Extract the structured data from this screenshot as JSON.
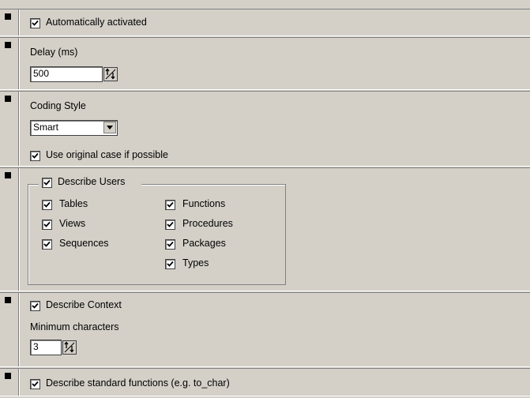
{
  "sections": {
    "auto_activated": {
      "label": "Automatically activated",
      "checked": true
    },
    "delay": {
      "label": "Delay (ms)",
      "value": "500"
    },
    "coding_style": {
      "label": "Coding Style",
      "selected": "Smart",
      "use_original_case": {
        "label": "Use original case if possible",
        "checked": true
      }
    },
    "describe_users": {
      "label": "Describe Users",
      "checked": true,
      "left_options": [
        {
          "label": "Tables",
          "checked": true
        },
        {
          "label": "Views",
          "checked": true
        },
        {
          "label": "Sequences",
          "checked": true
        }
      ],
      "right_options": [
        {
          "label": "Functions",
          "checked": true
        },
        {
          "label": "Procedures",
          "checked": true
        },
        {
          "label": "Packages",
          "checked": true
        },
        {
          "label": "Types",
          "checked": true
        }
      ]
    },
    "describe_context": {
      "label": "Describe Context",
      "checked": true,
      "min_chars_label": "Minimum characters",
      "min_chars_value": "3"
    },
    "describe_std_functions": {
      "label": "Describe standard functions (e.g. to_char)",
      "checked": true
    }
  }
}
